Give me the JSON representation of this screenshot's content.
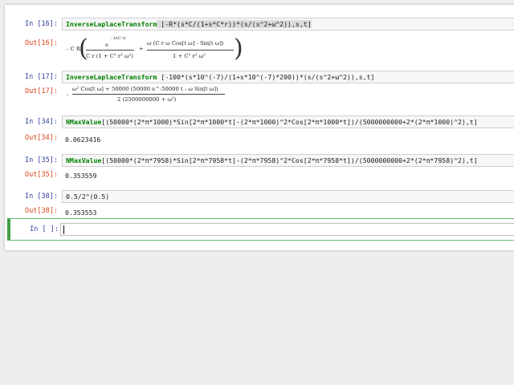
{
  "cells": [
    {
      "in_prompt": "In [16]:",
      "out_prompt": "Out[16]:",
      "input_fn": "InverseLaplaceTransform",
      "input_args": " [-R*(s*C/(1+s*C*r))*(s/(s^2+ω^2)),s,t]",
      "out": {
        "lead": "- C R",
        "t1_num": "e",
        "t1_exp": "- t/(C r)",
        "t1_den": "C r (1 + C² r² ω²)",
        "plus": "+",
        "t2_num": "ω (C r ω Cos[t ω] - Sin[t ω])",
        "t2_den": "1 + C² r² ω²"
      }
    },
    {
      "in_prompt": "In [17]:",
      "out_prompt": "Out[17]:",
      "input_fn": "InverseLaplaceTransform",
      "input_args": " [-100*(s*10^(-7)/(1+s*10^(-7)*200))*(s/(s^2+ω^2)),s,t]",
      "out": {
        "lead": "-",
        "num": "ω² Cos[t ω] + 50000 (50000 e^-50000 t - ω Sin[t ω])",
        "den": "2 (2500000000 + ω²)"
      }
    },
    {
      "in_prompt": "In [34]:",
      "out_prompt": "Out[34]:",
      "input_fn": "NMaxValue",
      "input_args": "[(50000*(2*π*1000)*Sin[2*π*1000*t]-(2*π*1000)^2*Cos[2*π*1000*t])/(5000000000+2*(2*π*1000)^2),t]",
      "output": "0.0623416"
    },
    {
      "in_prompt": "In [35]:",
      "out_prompt": "Out[35]:",
      "input_fn": "NMaxValue",
      "input_args": "[(50000*(2*π*7958)*Sin[2*π*7958*t]-(2*π*7958)^2*Cos[2*π*7958*t])/(5000000000+2*(2*π*7958)^2),t]",
      "output": "0.353559"
    },
    {
      "in_prompt": "In [38]:",
      "out_prompt": "Out[38]:",
      "input_code": "0.5/2^(0.5)",
      "output": "0.353553"
    }
  ],
  "active_cell": {
    "in_prompt": "In [ ]:"
  }
}
